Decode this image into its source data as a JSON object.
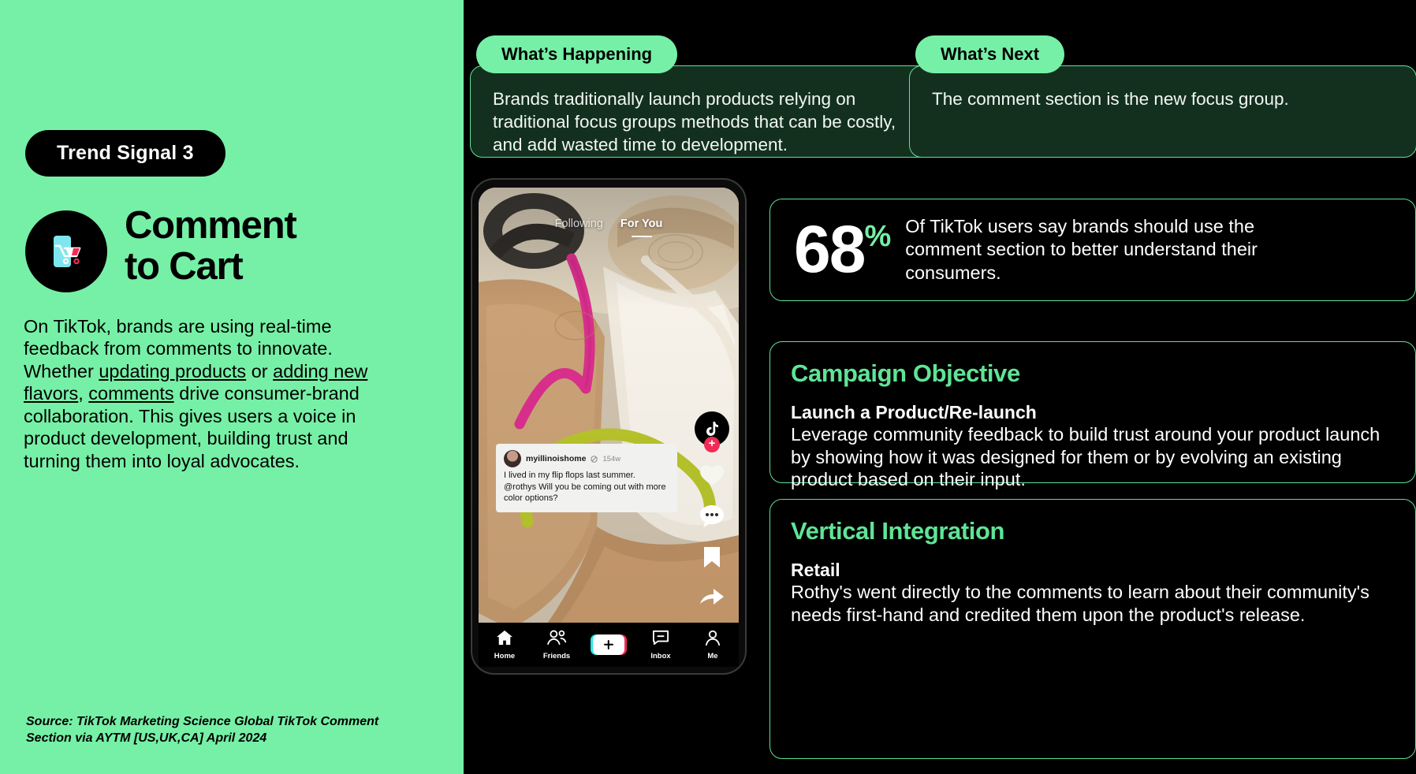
{
  "left": {
    "trend_label": "Trend Signal 3",
    "icon_name": "phone-cart-icon",
    "heading_line1": "Comment",
    "heading_line2": "to Cart",
    "body_pre": "On TikTok, brands are using real-time feedback from comments to innovate. Whether ",
    "body_link1": "updating products",
    "body_mid1": " or ",
    "body_link2": "adding new flavors",
    "body_mid2": ", ",
    "body_link3": "comments",
    "body_post": " drive consumer-brand collaboration. This gives users a voice in product development, building trust and turning them into loyal advocates.",
    "source": "Source: TikTok Marketing Science Global TikTok Comment Section via AYTM [US,UK,CA]  April 2024"
  },
  "whats_happening": {
    "tab_label": "What’s Happening",
    "body": "Brands traditionally launch products relying on traditional focus groups methods that can be costly, and add wasted time to development."
  },
  "whats_next": {
    "tab_label": "What’s Next",
    "body": "The comment section is the new focus group."
  },
  "stat": {
    "number": "68",
    "percent": "%",
    "text": "Of TikTok users say brands should use the comment section to better understand their consumers."
  },
  "campaign_objective": {
    "heading": "Campaign Objective",
    "subheading": "Launch a Product/Re-launch",
    "body": "Leverage community feedback to build trust around your product launch by showing how it was designed for them or by evolving an existing product based on their input."
  },
  "vertical_integration": {
    "heading": "Vertical Integration",
    "subheading": "Retail",
    "body": "Rothy's went directly to the comments to learn about their community's needs first-hand and credited them upon the product's release."
  },
  "phone": {
    "tab_following": "Following",
    "tab_for_you": "For You",
    "comment": {
      "username": "myillinoishome",
      "timestamp": "154w",
      "text": "I lived in my flip flops last summer. @rothys Will you be coming out with more color options?"
    },
    "rail": [
      {
        "icon": "tiktok-avatar-icon"
      },
      {
        "icon": "heart-icon"
      },
      {
        "icon": "comment-bubble-icon"
      },
      {
        "icon": "bookmark-icon"
      },
      {
        "icon": "share-arrow-icon"
      }
    ],
    "nav": [
      {
        "icon": "home-icon",
        "label": "Home"
      },
      {
        "icon": "friends-icon",
        "label": "Friends"
      },
      {
        "icon": "create-plus-icon",
        "label": ""
      },
      {
        "icon": "inbox-icon",
        "label": "Inbox"
      },
      {
        "icon": "profile-icon",
        "label": "Me"
      }
    ]
  },
  "colors": {
    "mint": "#76f0a6",
    "border_green": "#5fe496",
    "card_dark_green": "#13301f",
    "background": "#000000",
    "tiktok_pink": "#f02c56",
    "tiktok_cyan": "#29e5e7"
  }
}
